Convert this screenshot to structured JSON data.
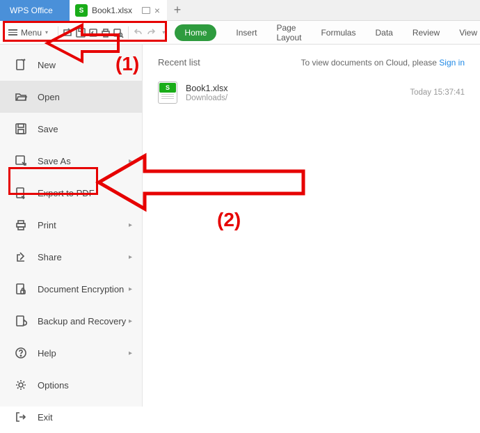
{
  "titlebar": {
    "app_name": "WPS Office",
    "tab_title": "Book1.xlsx",
    "newtab_glyph": "+"
  },
  "toolbar": {
    "menu_label": "Menu",
    "ribbon": {
      "home": "Home",
      "insert": "Insert",
      "page_layout": "Page Layout",
      "formulas": "Formulas",
      "data": "Data",
      "review": "Review",
      "view": "View"
    }
  },
  "sidebar": {
    "items": [
      {
        "label": "New",
        "has_submenu": false
      },
      {
        "label": "Open",
        "has_submenu": false,
        "active": true
      },
      {
        "label": "Save",
        "has_submenu": false
      },
      {
        "label": "Save As",
        "has_submenu": true
      },
      {
        "label": "Export to PDF",
        "has_submenu": false
      },
      {
        "label": "Print",
        "has_submenu": true
      },
      {
        "label": "Share",
        "has_submenu": true
      },
      {
        "label": "Document Encryption",
        "has_submenu": true
      },
      {
        "label": "Backup and Recovery",
        "has_submenu": true
      },
      {
        "label": "Help",
        "has_submenu": true
      },
      {
        "label": "Options",
        "has_submenu": false
      },
      {
        "label": "Exit",
        "has_submenu": false
      }
    ]
  },
  "content": {
    "recent_label": "Recent list",
    "cloud_prompt": "To view documents on Cloud, please ",
    "signin_label": "Sign in",
    "file": {
      "name": "Book1.xlsx",
      "path": "Downloads/",
      "time": "Today 15:37:41"
    }
  },
  "annotations": {
    "label1": "(1)",
    "label2": "(2)"
  }
}
